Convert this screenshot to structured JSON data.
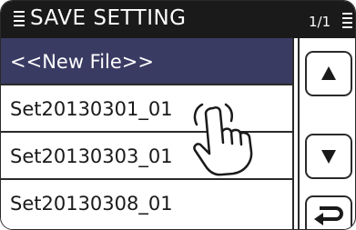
{
  "header": {
    "title": "SAVE SETTING",
    "page_indicator": "1/1",
    "menu_icon": "list-menu-icon",
    "page_icon": "list-menu-icon"
  },
  "list": {
    "items": [
      {
        "label": "<<New File>>",
        "selected": true
      },
      {
        "label": "Set20130301_01",
        "selected": false
      },
      {
        "label": "Set20130303_01",
        "selected": false
      },
      {
        "label": "Set20130308_01",
        "selected": false
      }
    ]
  },
  "side_buttons": {
    "up_icon": "triangle-up-icon",
    "down_icon": "triangle-down-icon",
    "back_icon": "return-arrow-icon"
  },
  "overlay": {
    "pointer_icon": "touch-hand-icon"
  },
  "colors": {
    "titlebar": "#1a1a1a",
    "selected_row": "#3a3b63",
    "border": "#2a2a2a"
  }
}
